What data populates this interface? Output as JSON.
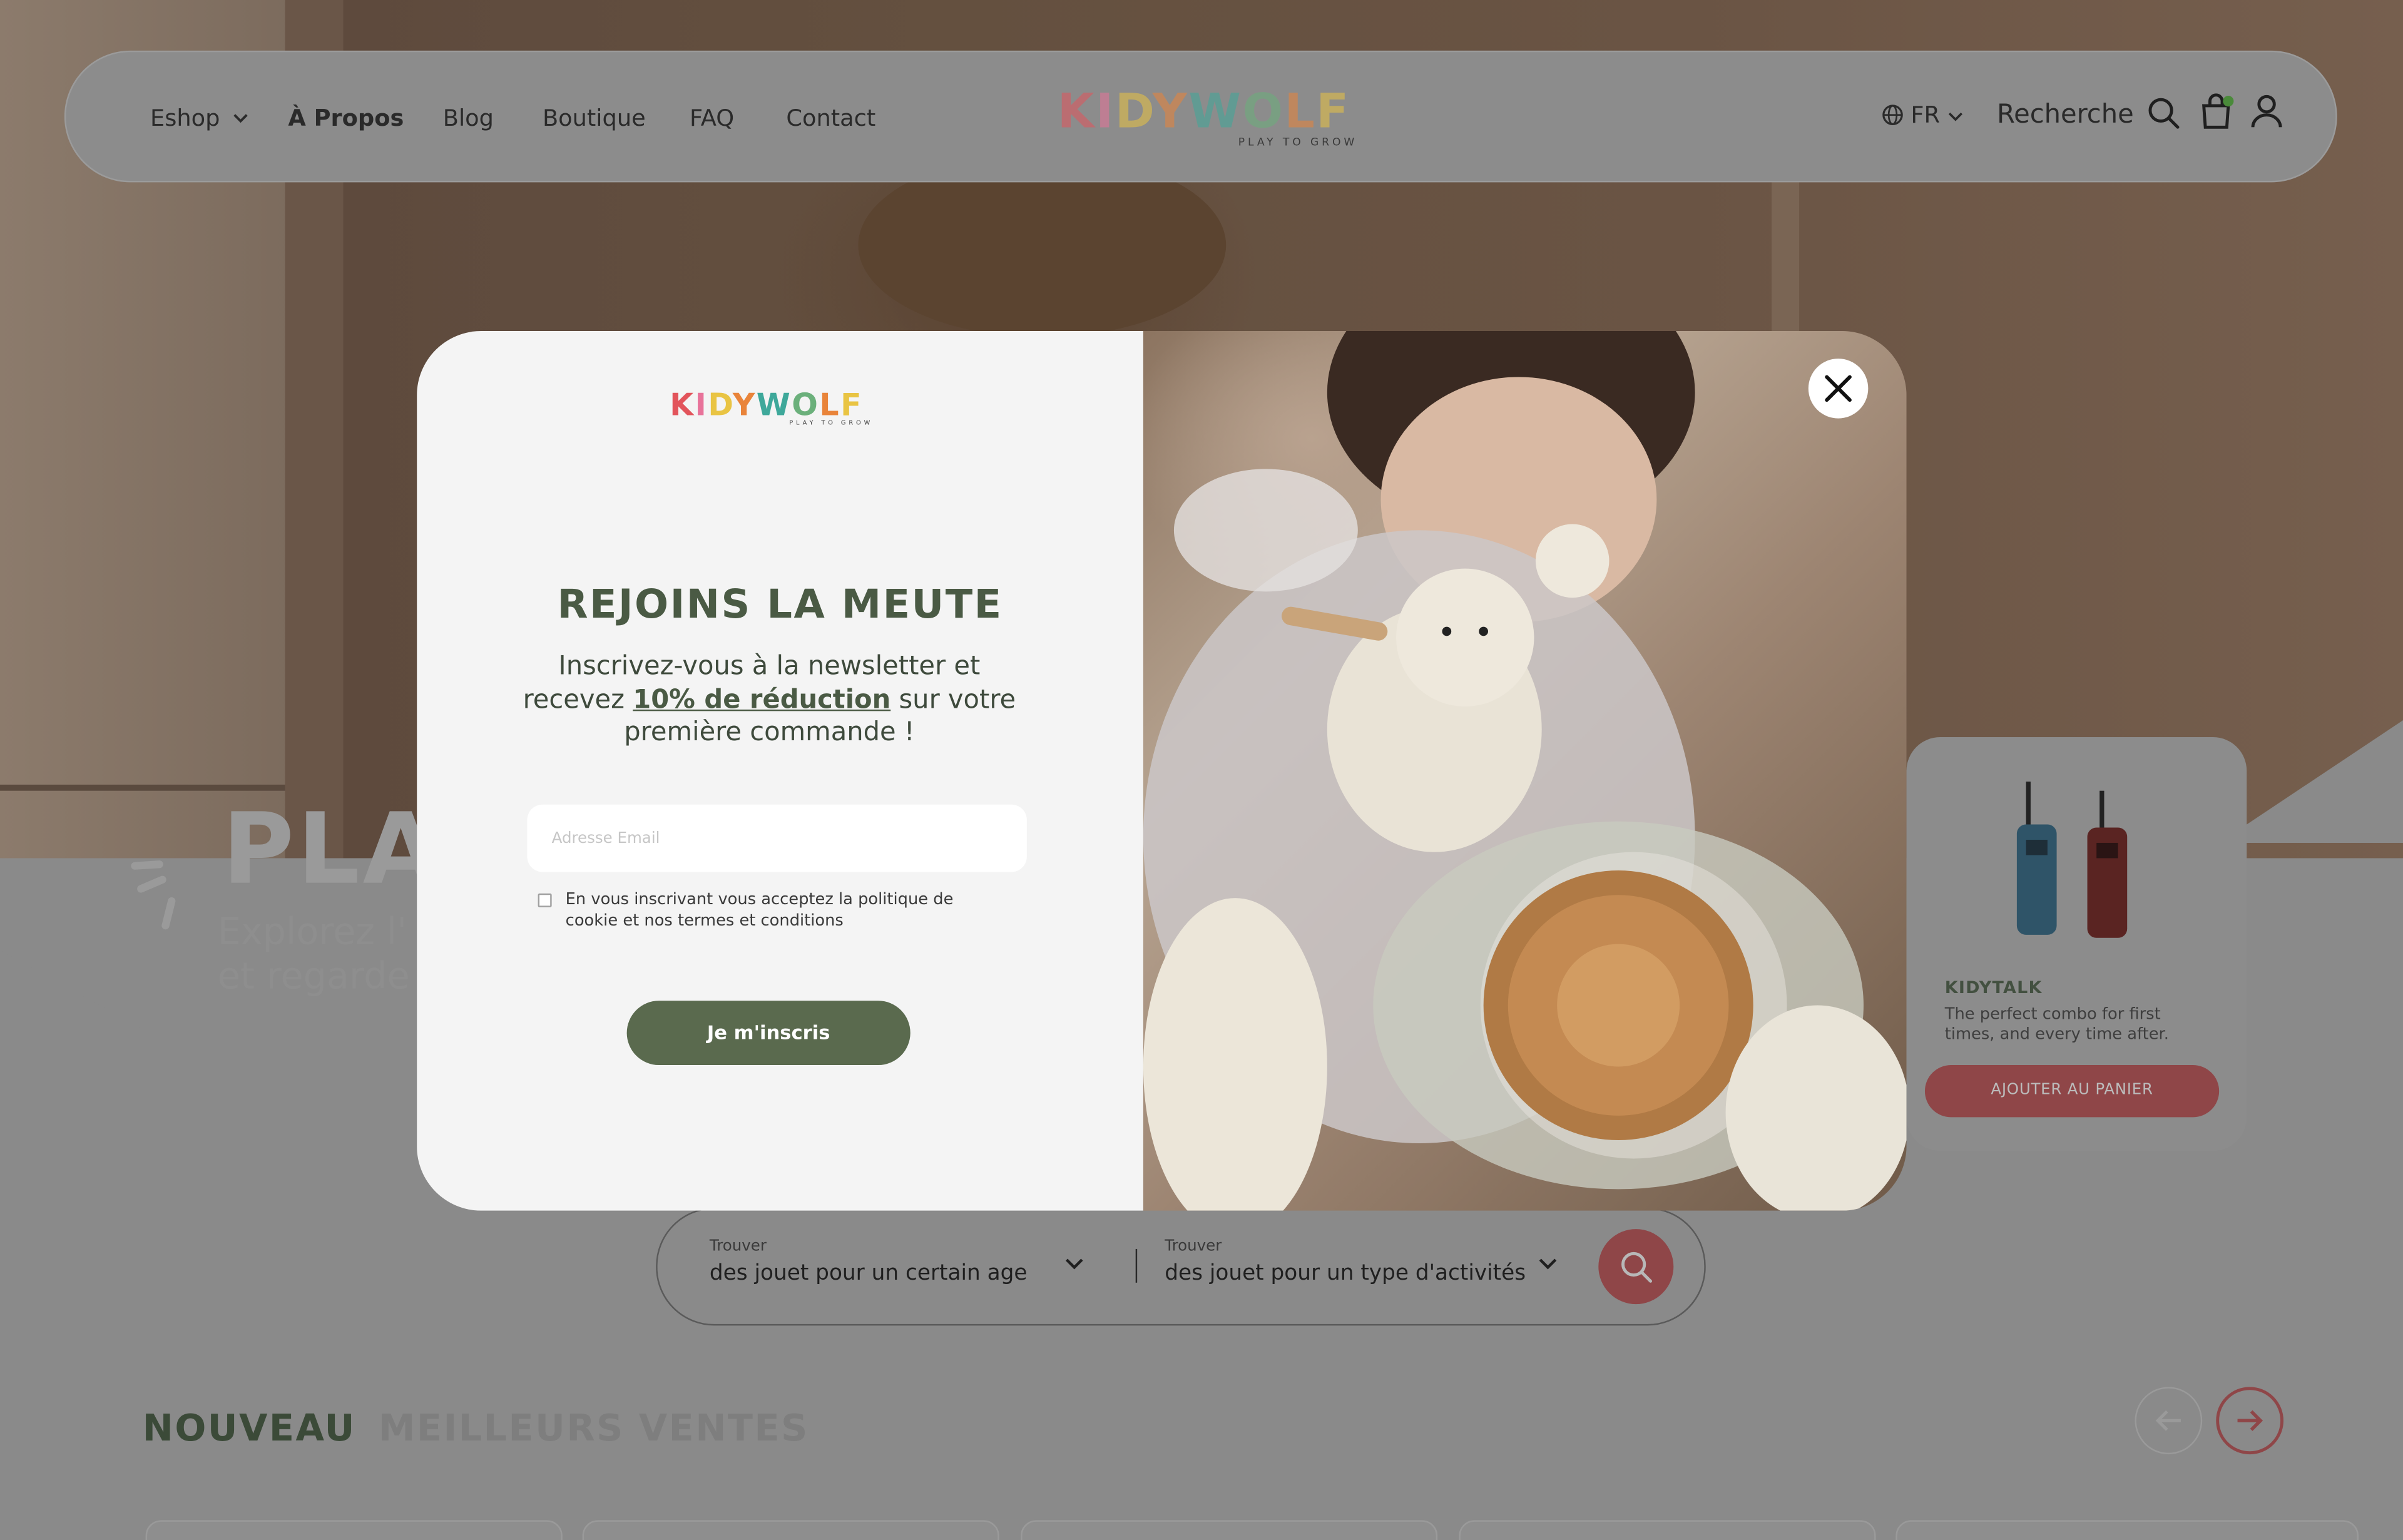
{
  "nav": {
    "items": [
      "Eshop",
      "À Propos",
      "Blog",
      "Boutique",
      "FAQ",
      "Contact"
    ],
    "language": "FR",
    "search_label": "Recherche"
  },
  "brand": {
    "name": "KIDYWOLF",
    "tagline": "PLAY TO GROW",
    "letter_colors": [
      "#e2545b",
      "#e8739a",
      "#e9c443",
      "#e9843a",
      "#3ea89a",
      "#6bb07b",
      "#e9843a",
      "#e9c443"
    ]
  },
  "hero": {
    "title": "PLAY",
    "subtitle_line1": "Explorez l'",
    "subtitle_line2": "et regarde"
  },
  "product": {
    "name": "KIDYTALK",
    "description": "The perfect combo for first times, and every time after.",
    "cta": "AJOUTER AU PANIER"
  },
  "search": {
    "field1_label": "Trouver",
    "field1_value": "des jouet pour un certain age",
    "field2_label": "Trouver",
    "field2_value": "des jouet pour un type d'activités"
  },
  "tabs": {
    "new": "NOUVEAU",
    "best": "MEILLEURS VENTES"
  },
  "modal": {
    "title": "REJOINS LA MEUTE",
    "text_before": "Inscrivez-vous à la newsletter et recevez ",
    "text_highlight": "10% de réduction",
    "text_after": " sur votre première commande !",
    "email_placeholder": "Adresse Email",
    "consent": "En vous inscrivant vous acceptez la politique de cookie et nos termes et conditions",
    "submit": "Je m'inscris"
  },
  "colors": {
    "accent_green": "#5a6a4e",
    "accent_red": "#c4545a"
  }
}
